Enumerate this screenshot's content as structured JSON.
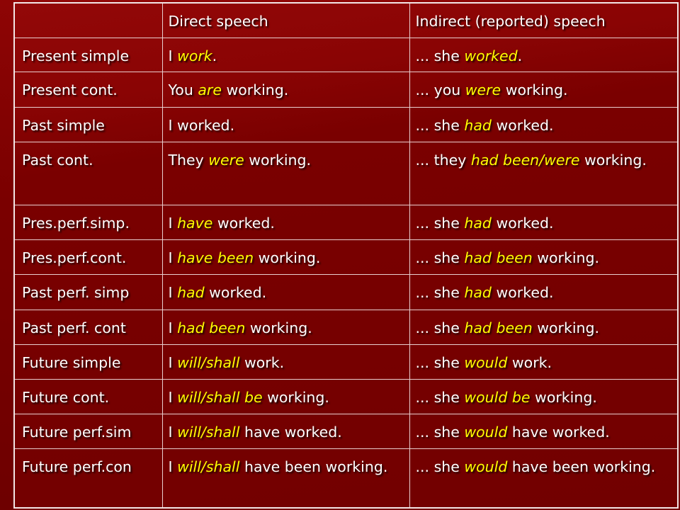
{
  "colors": {
    "background": "#7c0000",
    "text": "#ffffff",
    "highlight": "#ffff00",
    "grid": "#e9cfcf"
  },
  "header": {
    "tense": "",
    "direct": "Direct speech",
    "indirect": "Indirect (reported) speech"
  },
  "rows": [
    {
      "tense": "Present simple",
      "direct": [
        {
          "t": "I ",
          "h": false
        },
        {
          "t": "work",
          "h": true
        },
        {
          "t": ".",
          "h": false
        }
      ],
      "indirect": [
        {
          "t": "... she ",
          "h": false
        },
        {
          "t": "worked",
          "h": true
        },
        {
          "t": ".",
          "h": false
        }
      ]
    },
    {
      "tense": "Present cont.",
      "direct": [
        {
          "t": "You ",
          "h": false
        },
        {
          "t": "are",
          "h": true
        },
        {
          "t": " working.",
          "h": false
        }
      ],
      "indirect": [
        {
          "t": "... you ",
          "h": false
        },
        {
          "t": "were",
          "h": true
        },
        {
          "t": " working.",
          "h": false
        }
      ]
    },
    {
      "tense": "Past simple",
      "direct": [
        {
          "t": "I worked.",
          "h": false
        }
      ],
      "indirect": [
        {
          "t": "... she ",
          "h": false
        },
        {
          "t": "had",
          "h": true
        },
        {
          "t": " worked.",
          "h": false
        }
      ]
    },
    {
      "tense": "Past cont.",
      "direct": [
        {
          "t": "They ",
          "h": false
        },
        {
          "t": "were",
          "h": true
        },
        {
          "t": " working.",
          "h": false
        }
      ],
      "indirect": [
        {
          "t": "... they ",
          "h": false
        },
        {
          "t": "had been/were",
          "h": true
        },
        {
          "t": " working.",
          "h": false
        }
      ]
    },
    {
      "tense": "Pres.perf.simp.",
      "direct": [
        {
          "t": "I ",
          "h": false
        },
        {
          "t": "have",
          "h": true
        },
        {
          "t": " worked.",
          "h": false
        }
      ],
      "indirect": [
        {
          "t": "... she ",
          "h": false
        },
        {
          "t": "had",
          "h": true
        },
        {
          "t": " worked.",
          "h": false
        }
      ]
    },
    {
      "tense": "Pres.perf.cont.",
      "direct": [
        {
          "t": "I ",
          "h": false
        },
        {
          "t": "have been",
          "h": true
        },
        {
          "t": " working.",
          "h": false
        }
      ],
      "indirect": [
        {
          "t": "... she ",
          "h": false
        },
        {
          "t": "had been",
          "h": true
        },
        {
          "t": " working.",
          "h": false
        }
      ]
    },
    {
      "tense": "Past perf. simp",
      "direct": [
        {
          "t": "I ",
          "h": false
        },
        {
          "t": "had",
          "h": true
        },
        {
          "t": " worked.",
          "h": false
        }
      ],
      "indirect": [
        {
          "t": "... she ",
          "h": false
        },
        {
          "t": "had",
          "h": true
        },
        {
          "t": " worked.",
          "h": false
        }
      ]
    },
    {
      "tense": "Past perf. cont",
      "direct": [
        {
          "t": "I ",
          "h": false
        },
        {
          "t": "had been",
          "h": true
        },
        {
          "t": " working.",
          "h": false
        }
      ],
      "indirect": [
        {
          "t": "... she ",
          "h": false
        },
        {
          "t": "had been",
          "h": true
        },
        {
          "t": " working.",
          "h": false
        }
      ]
    },
    {
      "tense": "Future simple",
      "direct": [
        {
          "t": "I ",
          "h": false
        },
        {
          "t": "will/shall",
          "h": true
        },
        {
          "t": " work.",
          "h": false
        }
      ],
      "indirect": [
        {
          "t": "... she ",
          "h": false
        },
        {
          "t": "would",
          "h": true
        },
        {
          "t": " work.",
          "h": false
        }
      ]
    },
    {
      "tense": "Future cont.",
      "direct": [
        {
          "t": "I ",
          "h": false
        },
        {
          "t": "will/shall be",
          "h": true
        },
        {
          "t": " working.",
          "h": false
        }
      ],
      "indirect": [
        {
          "t": "... she ",
          "h": false
        },
        {
          "t": "would be",
          "h": true
        },
        {
          "t": " working.",
          "h": false
        }
      ]
    },
    {
      "tense": "Future perf.sim",
      "direct": [
        {
          "t": "I ",
          "h": false
        },
        {
          "t": "will/shall",
          "h": true
        },
        {
          "t": " have worked.",
          "h": false
        }
      ],
      "indirect": [
        {
          "t": "... she ",
          "h": false
        },
        {
          "t": "would",
          "h": true
        },
        {
          "t": " have worked.",
          "h": false
        }
      ]
    },
    {
      "tense": "Future perf.con",
      "direct": [
        {
          "t": "I ",
          "h": false
        },
        {
          "t": "will/shall",
          "h": true
        },
        {
          "t": " have been working.",
          "h": false
        }
      ],
      "indirect": [
        {
          "t": "... she ",
          "h": false
        },
        {
          "t": "would",
          "h": true
        },
        {
          "t": " have been working.",
          "h": false
        }
      ]
    }
  ]
}
